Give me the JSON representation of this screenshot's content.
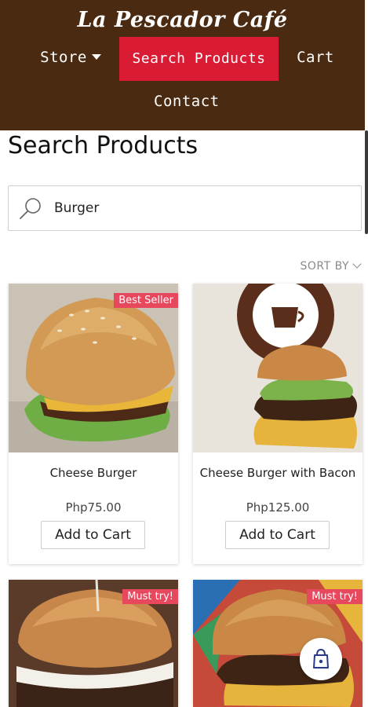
{
  "header": {
    "brand": "La Pescador Café",
    "nav": {
      "store": "Store",
      "search": "Search Products",
      "cart": "Cart",
      "contact": "Contact"
    }
  },
  "main": {
    "title": "Search Products",
    "search": {
      "value": "Burger"
    },
    "sort_label": "SORT BY"
  },
  "products": [
    {
      "name": "Cheese Burger",
      "price": "Php75.00",
      "badge": "Best Seller",
      "button": "Add to Cart"
    },
    {
      "name": "Cheese Burger with Bacon",
      "price": "Php125.00",
      "badge": "",
      "button": "Add to Cart"
    },
    {
      "name": "",
      "price": "",
      "badge": "Must try!",
      "button": ""
    },
    {
      "name": "",
      "price": "",
      "badge": "Must try!",
      "button": ""
    }
  ],
  "colors": {
    "header_bg": "#4a2b11",
    "nav_active": "#d91c34",
    "badge": "#e8485e"
  },
  "icons": {
    "search": "magnifier-icon",
    "store_dropdown": "chevron-down-icon",
    "sort_dropdown": "chevron-down-icon",
    "floating_cart": "shopping-bag-icon"
  }
}
